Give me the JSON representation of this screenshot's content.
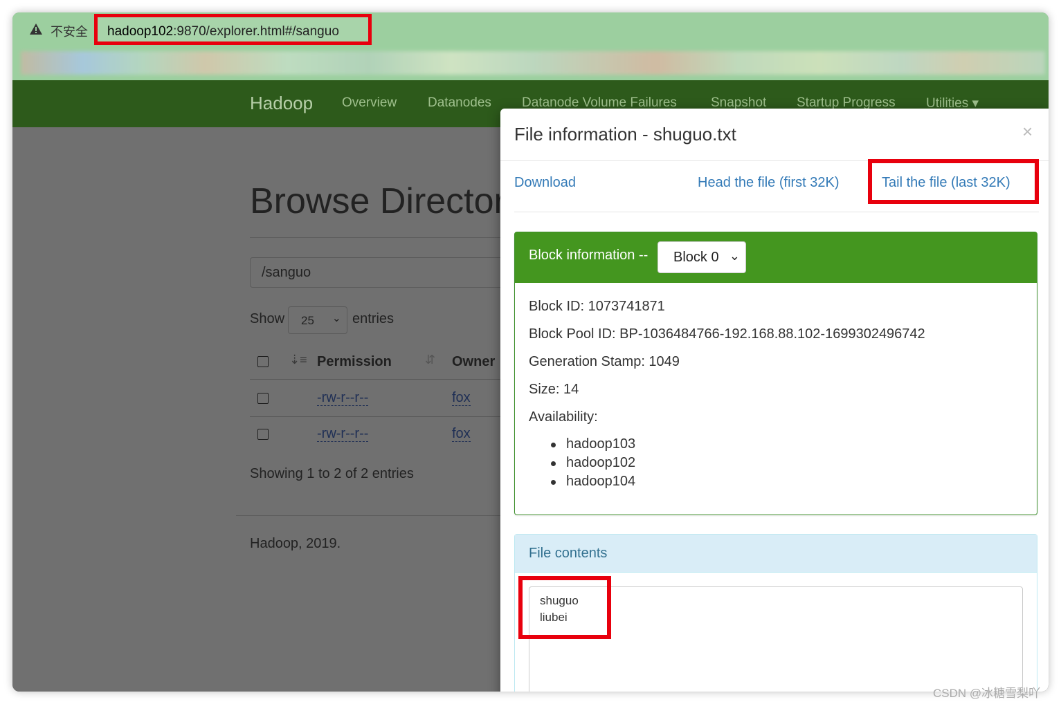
{
  "browser": {
    "security_label": "不安全",
    "url_host": "hadoop102",
    "url_rest": ":9870/explorer.html#/sanguo"
  },
  "navbar": {
    "brand": "Hadoop",
    "items": [
      "Overview",
      "Datanodes",
      "Datanode Volume Failures",
      "Snapshot",
      "Startup Progress",
      "Utilities ▾"
    ]
  },
  "page": {
    "heading": "Browse Director",
    "path_value": "/sanguo",
    "show_label": "Show",
    "show_value": "25",
    "entries_label": "entries",
    "columns": [
      "Permission",
      "Owner"
    ],
    "rows": [
      {
        "permission": "-rw-r--r--",
        "owner": "fox"
      },
      {
        "permission": "-rw-r--r--",
        "owner": "fox"
      }
    ],
    "showing": "Showing 1 to 2 of 2 entries",
    "footer": "Hadoop, 2019."
  },
  "modal": {
    "title": "File information - shuguo.txt",
    "close": "×",
    "links": {
      "download": "Download",
      "head": "Head the file (first 32K)",
      "tail": "Tail the file (last 32K)"
    },
    "block": {
      "label": "Block information --",
      "selected": "Block 0",
      "block_id": "Block ID: 1073741871",
      "pool_id": "Block Pool ID: BP-1036484766-192.168.88.102-1699302496742",
      "generation": "Generation Stamp: 1049",
      "size": "Size: 14",
      "availability_label": "Availability:",
      "availability": [
        "hadoop103",
        "hadoop102",
        "hadoop104"
      ]
    },
    "contents": {
      "label": "File contents",
      "lines": [
        "shuguo",
        "liubei"
      ]
    }
  },
  "watermark": "CSDN @冰糖雪梨吖",
  "colors": {
    "navbar": "#2d5a1b",
    "block_header": "#44961f",
    "link": "#337ab7",
    "highlight": "#e8000d",
    "contents_header": "#d9edf7"
  }
}
